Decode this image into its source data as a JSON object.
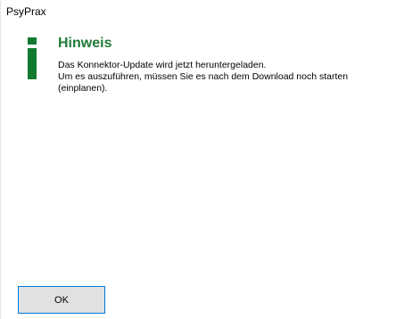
{
  "window": {
    "title": "PsyPrax"
  },
  "dialog": {
    "icon": "info-icon",
    "heading": "Hinweis",
    "message_lines": [
      "Das Konnektor-Update wird jetzt heruntergeladen.",
      "Um es auszuführen, müssen Sie es nach dem Download noch starten",
      "(einplanen)."
    ],
    "ok_label": "OK"
  },
  "colors": {
    "accent_green": "#1f7a37",
    "button_border": "#0078d7"
  }
}
